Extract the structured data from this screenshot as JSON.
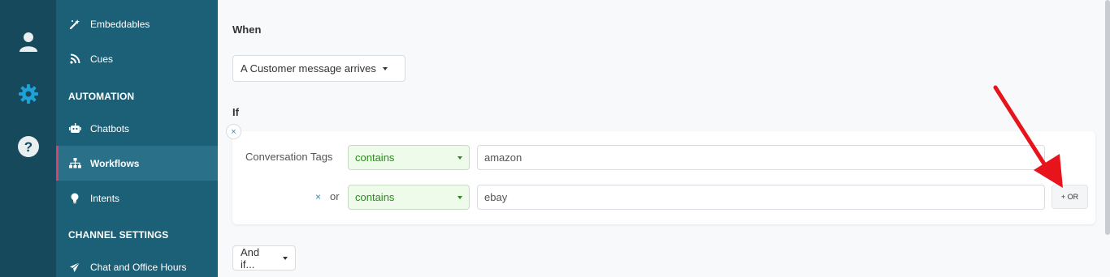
{
  "rail": {
    "icons": [
      "user-icon",
      "gear-icon",
      "help-icon"
    ],
    "accent": "#1ea1d6"
  },
  "sidebar": {
    "items_top": [
      {
        "label": "Embeddables",
        "icon": "wand-icon"
      },
      {
        "label": "Cues",
        "icon": "rss-icon"
      }
    ],
    "automation_header": "AUTOMATION",
    "automation_items": [
      {
        "label": "Chatbots",
        "icon": "robot-icon"
      },
      {
        "label": "Workflows",
        "icon": "sitemap-icon",
        "active": true
      },
      {
        "label": "Intents",
        "icon": "lightbulb-icon"
      }
    ],
    "channel_header": "CHANNEL SETTINGS",
    "channel_items": [
      {
        "label": "Chat and Office Hours",
        "icon": "paper-plane-icon"
      }
    ]
  },
  "main": {
    "when_label": "When",
    "trigger_select": "A Customer message arrives",
    "if_label": "If",
    "remove_condition": "×",
    "conditions": [
      {
        "label": "Conversation Tags",
        "operator": "contains",
        "value": "amazon"
      },
      {
        "label": "or",
        "remove": "×",
        "operator": "contains",
        "value": "ebay"
      }
    ],
    "or_button": "+ OR",
    "and_if_select": "And if..."
  },
  "colors": {
    "rail_bg": "#15495b",
    "sidebar_bg": "#1c6077",
    "active_marker": "#d6426c",
    "operator_green": "#2a8a1c",
    "annotation_arrow": "#e8141c"
  }
}
